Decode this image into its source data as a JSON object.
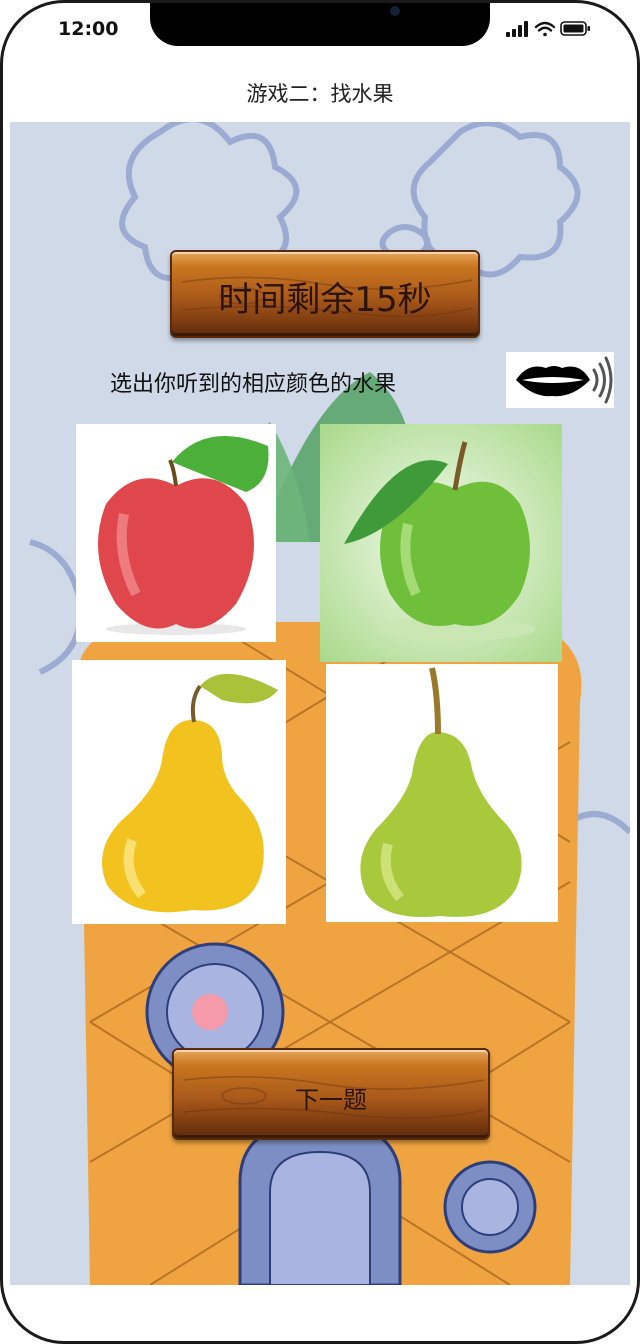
{
  "status_bar": {
    "time": "12:00"
  },
  "navbar": {
    "title": "游戏二：找水果"
  },
  "game": {
    "timer_label": "时间剩余15秒",
    "instruction": "选出你听到的相应颜色的水果",
    "speaker_icon": "mouth-sound-icon",
    "options": [
      {
        "name": "red-apple",
        "color": "#e0474c"
      },
      {
        "name": "green-apple",
        "color": "#6fbf3a"
      },
      {
        "name": "yellow-pear",
        "color": "#f2c21e"
      },
      {
        "name": "green-pear",
        "color": "#a8c93c"
      }
    ],
    "next_label": "下一题"
  },
  "colors": {
    "wood": "#a9591a",
    "stage_bg": "#cfd9e8"
  }
}
